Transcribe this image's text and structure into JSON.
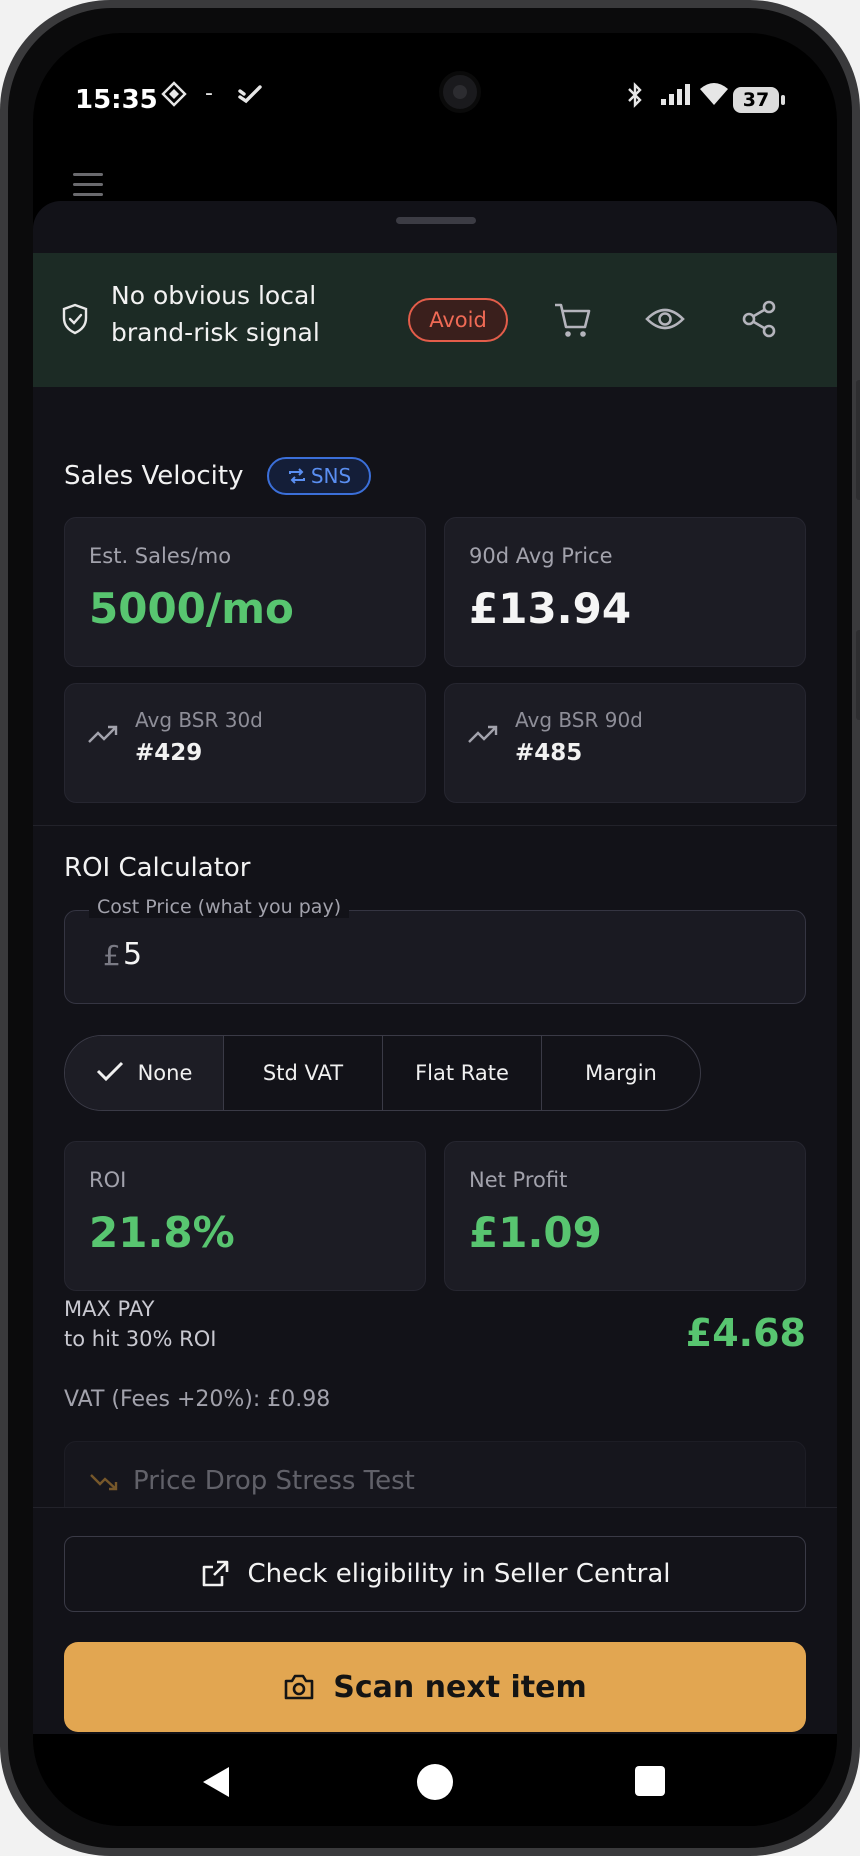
{
  "status_bar": {
    "time": "15:35",
    "dash": "-",
    "battery": "37",
    "icons": [
      "diamond-grid-icon",
      "check-swoosh-icon",
      "bluetooth-icon",
      "signal-icon",
      "wifi-icon",
      "battery-icon"
    ]
  },
  "risk_banner": {
    "text": "No obvious local brand-risk signal",
    "badge": "Avoid",
    "actions": [
      "cart-icon",
      "eye-icon",
      "share-icon"
    ]
  },
  "sales_velocity": {
    "title": "Sales Velocity",
    "badge": "SNS",
    "est_sales": {
      "label": "Est. Sales/mo",
      "value": "5000/mo"
    },
    "avg_price": {
      "label": "90d Avg Price",
      "value": "£13.94"
    },
    "bsr_30": {
      "label": "Avg BSR 30d",
      "value": "#429"
    },
    "bsr_90": {
      "label": "Avg BSR 90d",
      "value": "#485"
    }
  },
  "roi_calculator": {
    "title": "ROI Calculator",
    "cost_label": "Cost Price (what you pay)",
    "currency_prefix": "£",
    "cost_value": "5",
    "vat_options": [
      {
        "label": "None",
        "selected": true
      },
      {
        "label": "Std VAT",
        "selected": false
      },
      {
        "label": "Flat Rate",
        "selected": false
      },
      {
        "label": "Margin",
        "selected": false
      }
    ],
    "roi": {
      "label": "ROI",
      "value": "21.8%"
    },
    "net_profit": {
      "label": "Net Profit",
      "value": "£1.09"
    },
    "max_pay_label": "MAX PAY",
    "max_pay_sub": "to hit 30% ROI",
    "max_pay_value": "£4.68",
    "vat_note": "VAT (Fees +20%): £0.98",
    "stress_test": "Price Drop Stress Test"
  },
  "actions": {
    "eligibility": "Check eligibility in Seller Central",
    "scan": "Scan next item"
  },
  "colors": {
    "accent": "#e2a651",
    "positive": "#58c570",
    "danger": "#e35d4a",
    "info": "#3b6fd9",
    "banner_bg": "#1c2b25",
    "sheet_bg": "#121218"
  }
}
